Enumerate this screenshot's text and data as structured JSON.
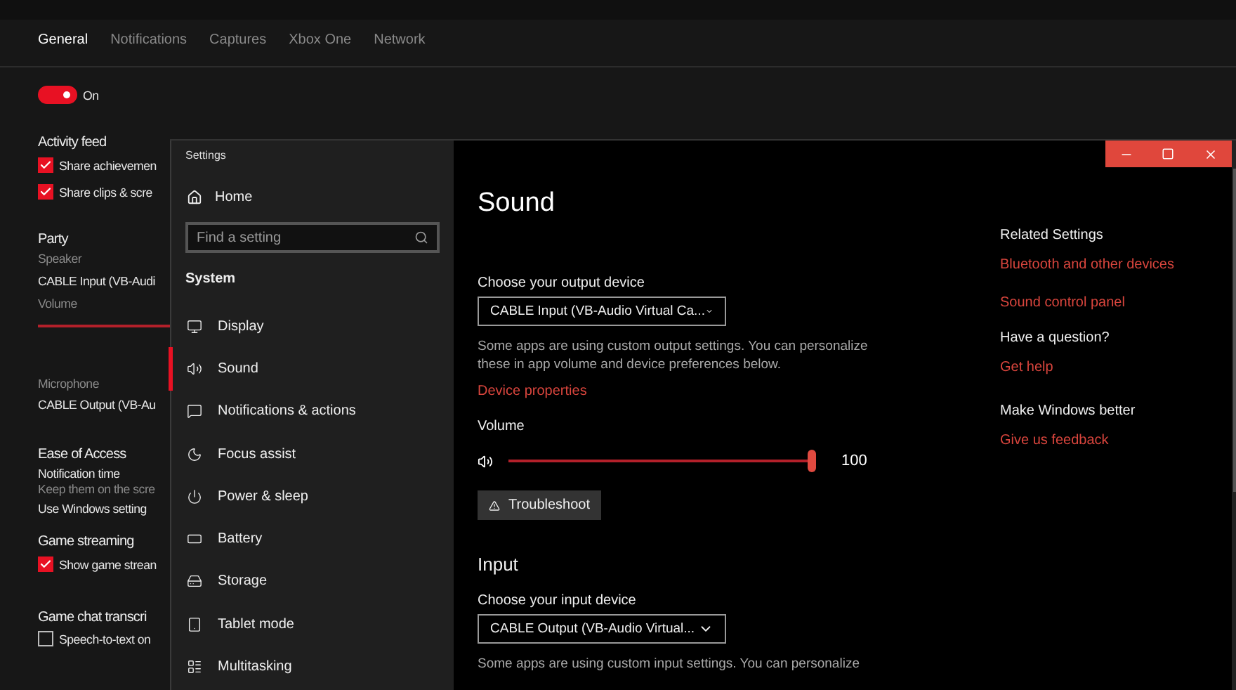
{
  "app": {
    "tabs": [
      {
        "label": "General",
        "selected": true
      },
      {
        "label": "Notifications",
        "selected": false
      },
      {
        "label": "Captures",
        "selected": false
      },
      {
        "label": "Xbox One",
        "selected": false
      },
      {
        "label": "Network",
        "selected": false
      }
    ],
    "live_tile": {
      "on": true,
      "label": "On"
    },
    "activity_feed": {
      "heading": "Activity feed",
      "options": [
        {
          "label": "Share achievemen",
          "checked": true
        },
        {
          "label": "Share clips & scre",
          "checked": true
        }
      ]
    },
    "party": {
      "heading": "Party",
      "speaker_label": "Speaker",
      "speaker": "CABLE Input (VB-Audi",
      "volume_label": "Volume",
      "volume": {
        "level": 1
      },
      "microphone_label": "Microphone",
      "microphone": "CABLE Output (VB-Au"
    },
    "ease_of_access": {
      "heading": "Ease of Access",
      "setting": "Notification time",
      "hint": "Keep them on the scre",
      "value": "Use Windows setting"
    },
    "game_streaming": {
      "heading": "Game streaming",
      "options": [
        {
          "label": "Show game strean",
          "checked": true
        }
      ]
    },
    "game_chat": {
      "heading": "Game chat transcri",
      "options": [
        {
          "label": "Speech-to-text on",
          "checked": false
        }
      ]
    }
  },
  "settings": {
    "title": "Settings",
    "home": "Home",
    "search": {
      "placeholder": "Find a setting"
    },
    "group": "System",
    "nav": [
      {
        "label": "Display",
        "selected": false
      },
      {
        "label": "Sound",
        "selected": true
      },
      {
        "label": "Notifications & actions",
        "selected": false
      },
      {
        "label": "Focus assist",
        "selected": false
      },
      {
        "label": "Power & sleep",
        "selected": false
      },
      {
        "label": "Battery",
        "selected": false
      },
      {
        "label": "Storage",
        "selected": false
      },
      {
        "label": "Tablet mode",
        "selected": false
      },
      {
        "label": "Multitasking",
        "selected": false
      }
    ],
    "page_title": "Sound",
    "output": {
      "label": "Choose your output device",
      "device": "CABLE Input (VB-Audio Virtual Ca...",
      "note": "Some apps are using custom output settings. You can personalize these in app volume and device preferences below.",
      "link": "Device properties"
    },
    "volume": {
      "label": "Volume",
      "level": 1,
      "reading": "100"
    },
    "troubleshoot": "Troubleshoot",
    "input": {
      "heading": "Input",
      "label": "Choose your input device",
      "device": "CABLE Output (VB-Audio Virtual...",
      "note": "Some apps are using custom input settings. You can personalize"
    },
    "related": [
      {
        "heading": "Related Settings",
        "links": [
          "Bluetooth and other devices",
          "Sound control panel"
        ]
      },
      {
        "heading": "Have a question?",
        "links": [
          "Get help"
        ]
      },
      {
        "heading": "Make Windows better",
        "links": [
          "Give us feedback"
        ]
      }
    ]
  }
}
